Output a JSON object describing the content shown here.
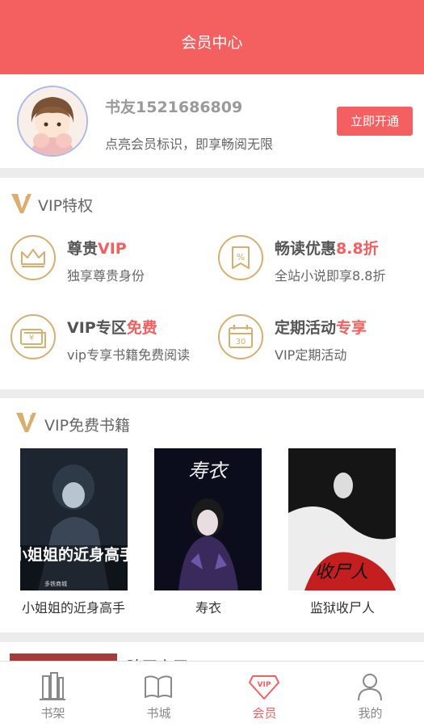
{
  "header": {
    "title": "会员中心"
  },
  "user": {
    "name": "书友1521686809",
    "subtitle": "点亮会员标识，即享畅阅无限",
    "open_button": "立即开通"
  },
  "privileges": {
    "title": "VIP特权",
    "items": [
      {
        "title": "尊贵",
        "highlight": "VIP",
        "sub": "独享尊贵身份",
        "icon": "crown-icon"
      },
      {
        "title": "畅读优惠",
        "highlight": "8.8折",
        "sub": "全站小说即享8.8折",
        "icon": "discount-tag-icon"
      },
      {
        "title": "VIP专区",
        "highlight": "免费",
        "sub": "vip专享书籍免费阅读",
        "icon": "ticket-icon"
      },
      {
        "title": "定期活动",
        "highlight": "专享",
        "sub": "VIP定期活动",
        "icon": "calendar-icon"
      }
    ]
  },
  "free_books": {
    "title": "VIP免费书籍",
    "books": [
      {
        "title": "小姐姐的近身高手",
        "cover_text": "小姐姐的近身高手",
        "cover_author": "多铁商城"
      },
      {
        "title": "寿衣",
        "cover_text": "寿衣"
      },
      {
        "title": "监狱收尸人",
        "cover_text": "收尸人"
      }
    ]
  },
  "next_section_title": "睥瓦之王",
  "tabs": [
    {
      "label": "书架",
      "icon": "bookshelf-icon"
    },
    {
      "label": "书城",
      "icon": "open-book-icon"
    },
    {
      "label": "会员",
      "icon": "vip-diamond-icon",
      "active": true
    },
    {
      "label": "我的",
      "icon": "user-icon"
    }
  ],
  "colors": {
    "accent": "#f4605f",
    "gold": "#d9ae6e"
  }
}
